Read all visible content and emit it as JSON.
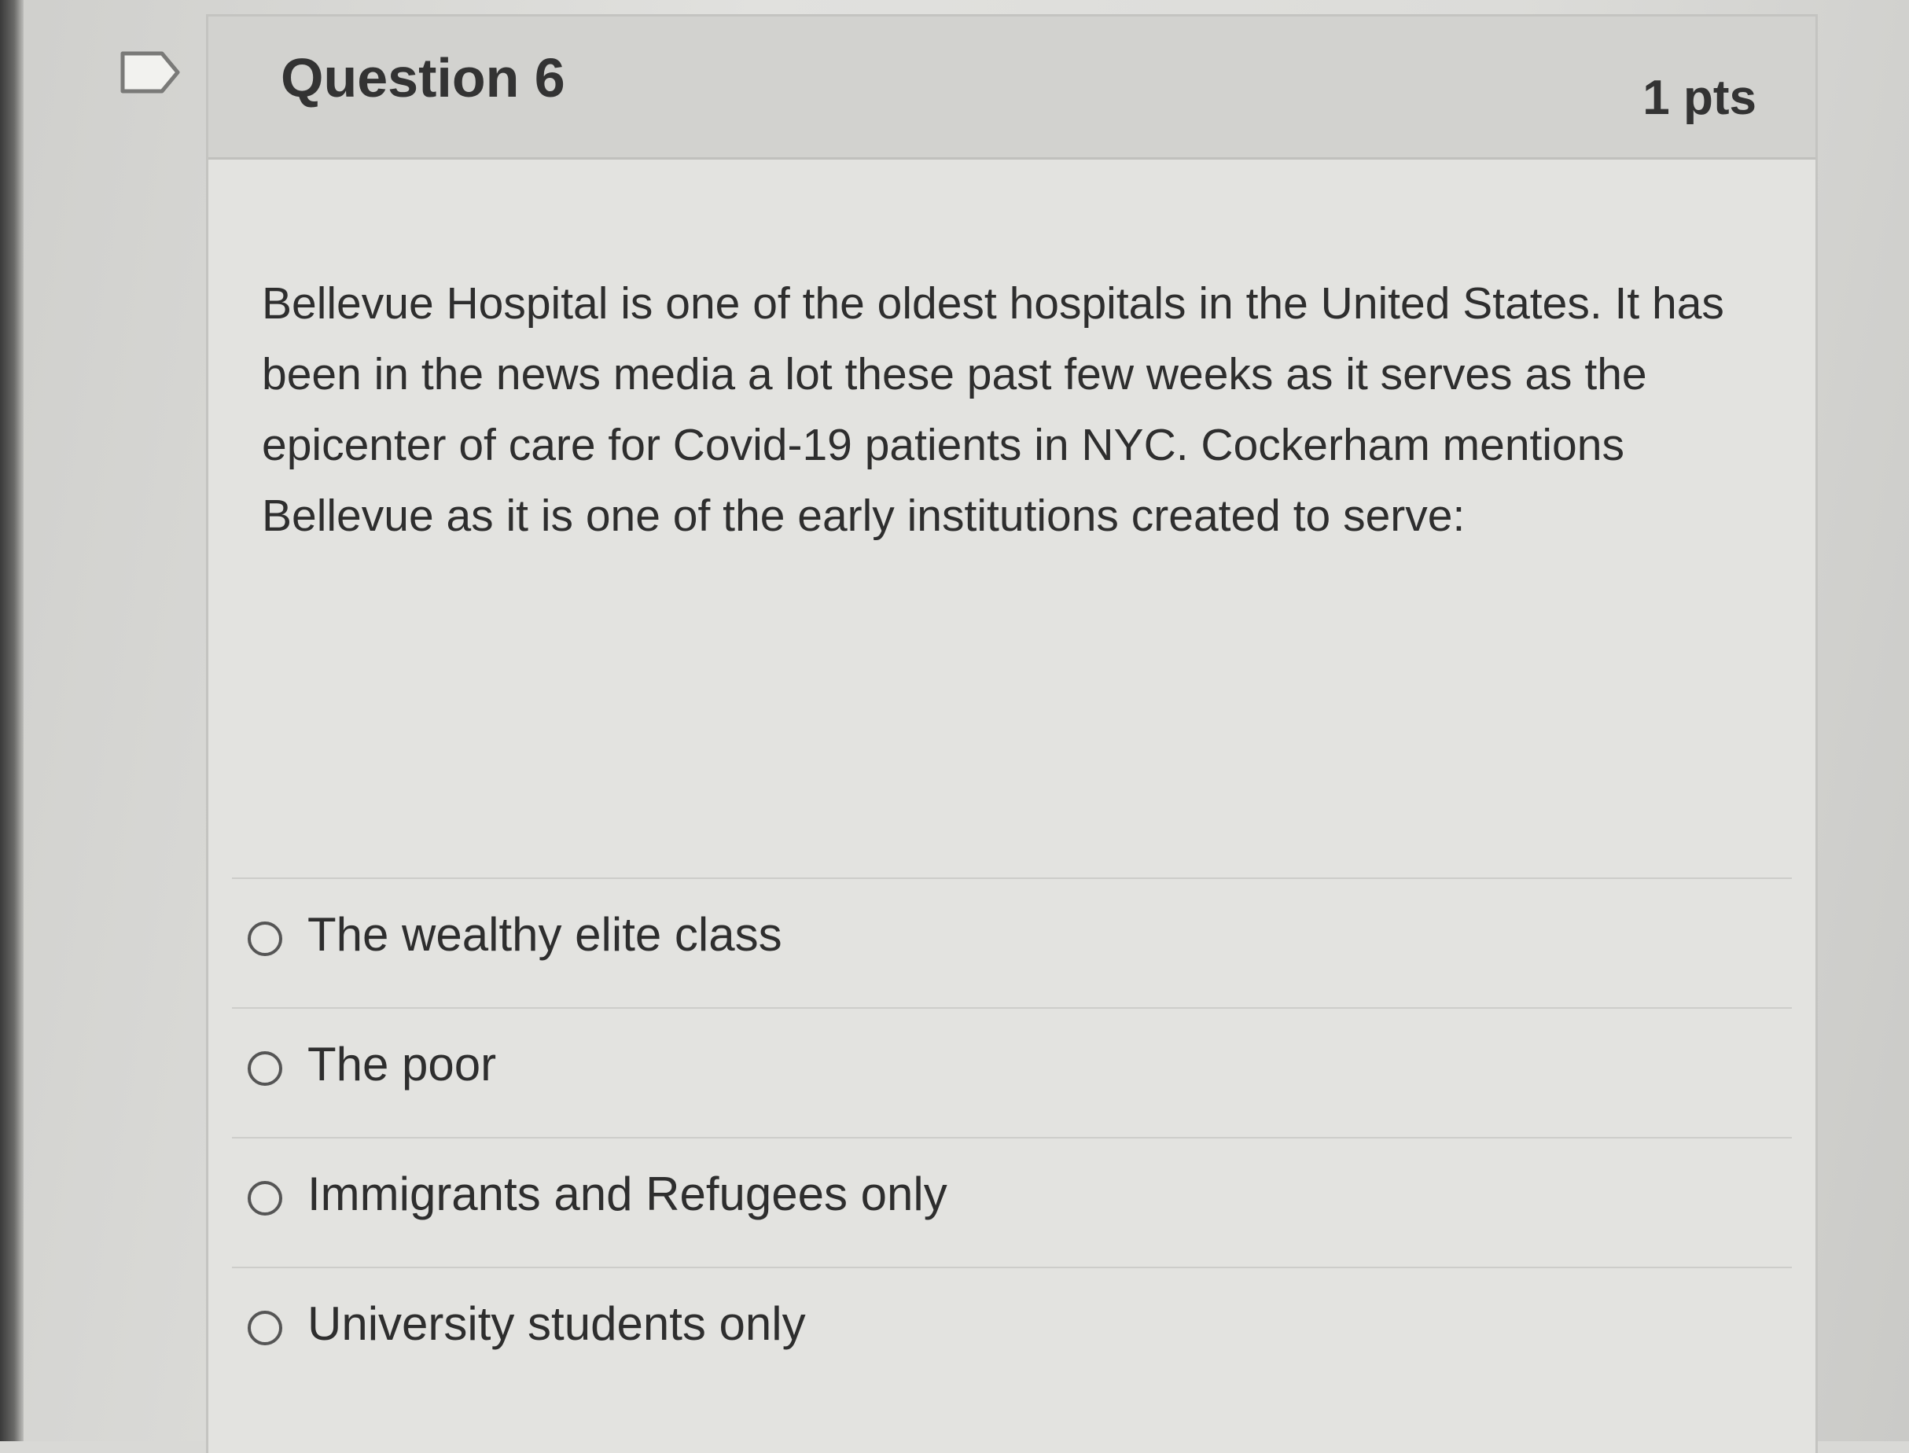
{
  "question": {
    "title": "Question 6",
    "points": "1 pts",
    "text": "Bellevue Hospital is one of the oldest hospitals in the United States. It has been in the news media a lot these past few weeks as it serves as the epicenter of care for Covid-19 patients in NYC. Cockerham mentions Bellevue as it is one of the early institutions created to serve:",
    "flag_icon": "flag-icon"
  },
  "answers": [
    {
      "label": "The wealthy elite class",
      "selected": false
    },
    {
      "label": "The poor",
      "selected": false
    },
    {
      "label": "Immigrants and Refugees only",
      "selected": false
    },
    {
      "label": "University students only",
      "selected": false
    }
  ]
}
